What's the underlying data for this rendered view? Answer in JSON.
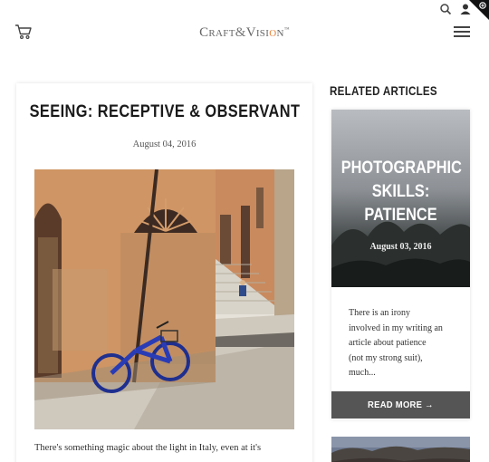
{
  "header": {
    "logo_part1": "Craft",
    "logo_amp": "&",
    "logo_part2": "Visi",
    "logo_o": "o",
    "logo_part3": "n",
    "logo_tm": "™"
  },
  "icons": {
    "cart": "shopping-cart-icon",
    "search": "search-icon",
    "user": "user-icon",
    "menu": "hamburger-menu-icon",
    "corner": "corner-badge-icon"
  },
  "article": {
    "title": "SEEING: RECEPTIVE & OBSERVANT",
    "date": "August 04, 2016",
    "excerpt": "There's something magic about the light in Italy, even at it's"
  },
  "sidebar": {
    "heading": "RELATED ARTICLES",
    "cards": [
      {
        "title_line1": "PHOTOGRAPHIC",
        "title_line2": "SKILLS:",
        "title_line3": "PATIENCE",
        "date": "August 03, 2016",
        "excerpt_line1": "There is an irony",
        "excerpt_line2": "involved in my writing an",
        "excerpt_line3": "article about patience",
        "excerpt_line4": "(not my strong suit),",
        "excerpt_line5": "much...",
        "button": "READ MORE →"
      }
    ]
  },
  "colors": {
    "accent": "#e8813a",
    "button_bg": "#555555"
  }
}
